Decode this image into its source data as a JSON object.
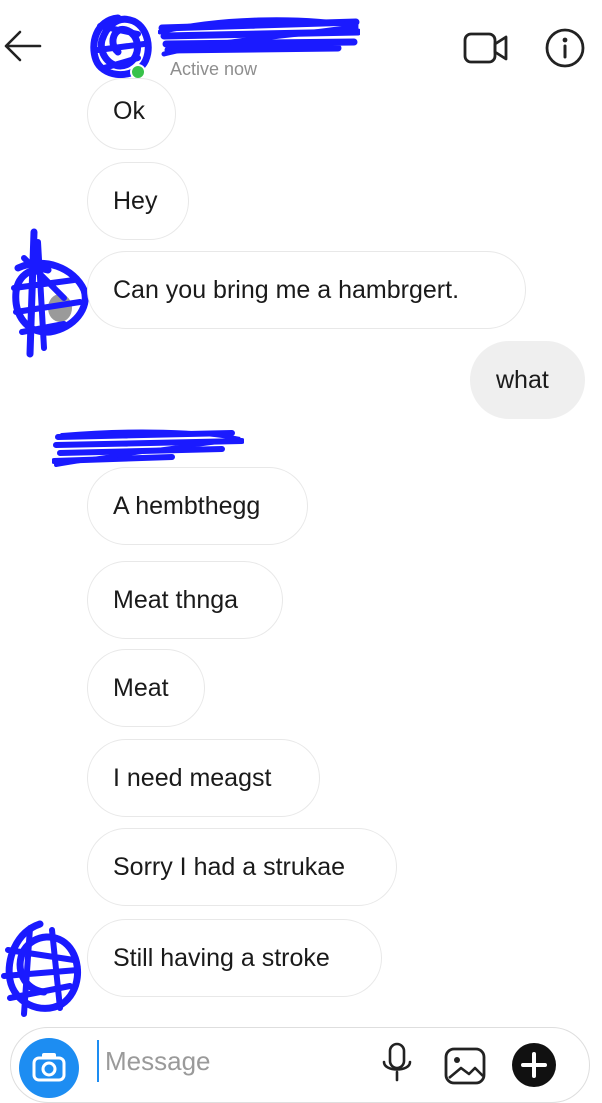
{
  "header": {
    "status": "Active now",
    "icons": [
      "back-arrow-icon",
      "video-call-icon",
      "info-icon"
    ]
  },
  "messages": [
    {
      "side": "received",
      "text": "Ok"
    },
    {
      "side": "received",
      "text": "Hey"
    },
    {
      "side": "received",
      "text": "Can you bring me a hambrgert."
    },
    {
      "side": "sent",
      "text": "what"
    },
    {
      "side": "received",
      "text": "A hembthegg"
    },
    {
      "side": "received",
      "text": "Meat thnga"
    },
    {
      "side": "received",
      "text": "Meat"
    },
    {
      "side": "received",
      "text": "I need meagst"
    },
    {
      "side": "received",
      "text": "Sorry I had a strukae"
    },
    {
      "side": "received",
      "text": "Still having a stroke"
    }
  ],
  "composer": {
    "placeholder": "Message",
    "icons": [
      "camera-icon",
      "microphone-icon",
      "gallery-icon",
      "plus-icon"
    ]
  },
  "colors": {
    "accent": "#1d8df2",
    "online": "#38c24a",
    "redaction": "#1a1aff",
    "sent_bubble": "#efefef"
  }
}
